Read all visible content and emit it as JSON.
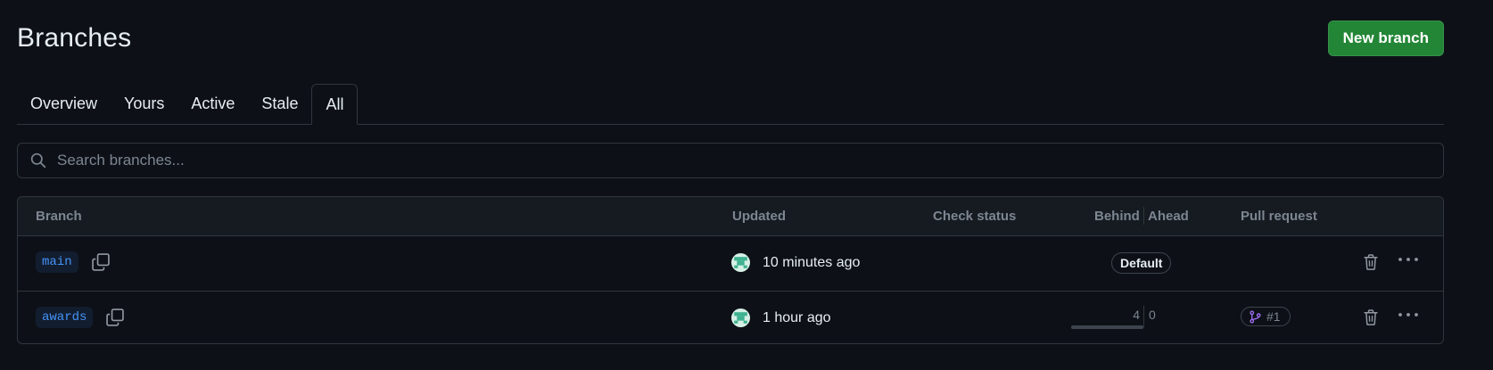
{
  "page": {
    "title": "Branches"
  },
  "header": {
    "new_branch_label": "New branch",
    "accent_color": "#238636"
  },
  "tabs": [
    {
      "label": "Overview",
      "selected": false
    },
    {
      "label": "Yours",
      "selected": false
    },
    {
      "label": "Active",
      "selected": false
    },
    {
      "label": "Stale",
      "selected": false
    },
    {
      "label": "All",
      "selected": true
    }
  ],
  "search": {
    "placeholder": "Search branches...",
    "value": "",
    "icon": "search-icon"
  },
  "table": {
    "columns": {
      "branch": "Branch",
      "updated": "Updated",
      "check_status": "Check status",
      "behind": "Behind",
      "ahead": "Ahead",
      "pull_request": "Pull request"
    },
    "rows": [
      {
        "branch": "main",
        "updated": "10 minutes ago",
        "default_badge": "Default",
        "pull_request": ""
      },
      {
        "branch": "awards",
        "updated": "1 hour ago",
        "behind": "4",
        "ahead": "0",
        "behind_fraction": 1.0,
        "pull_request": "#1"
      }
    ]
  },
  "colors": {
    "background": "#0d1117",
    "branch_link": "#4493f8",
    "pr_icon": "#a371f7"
  }
}
